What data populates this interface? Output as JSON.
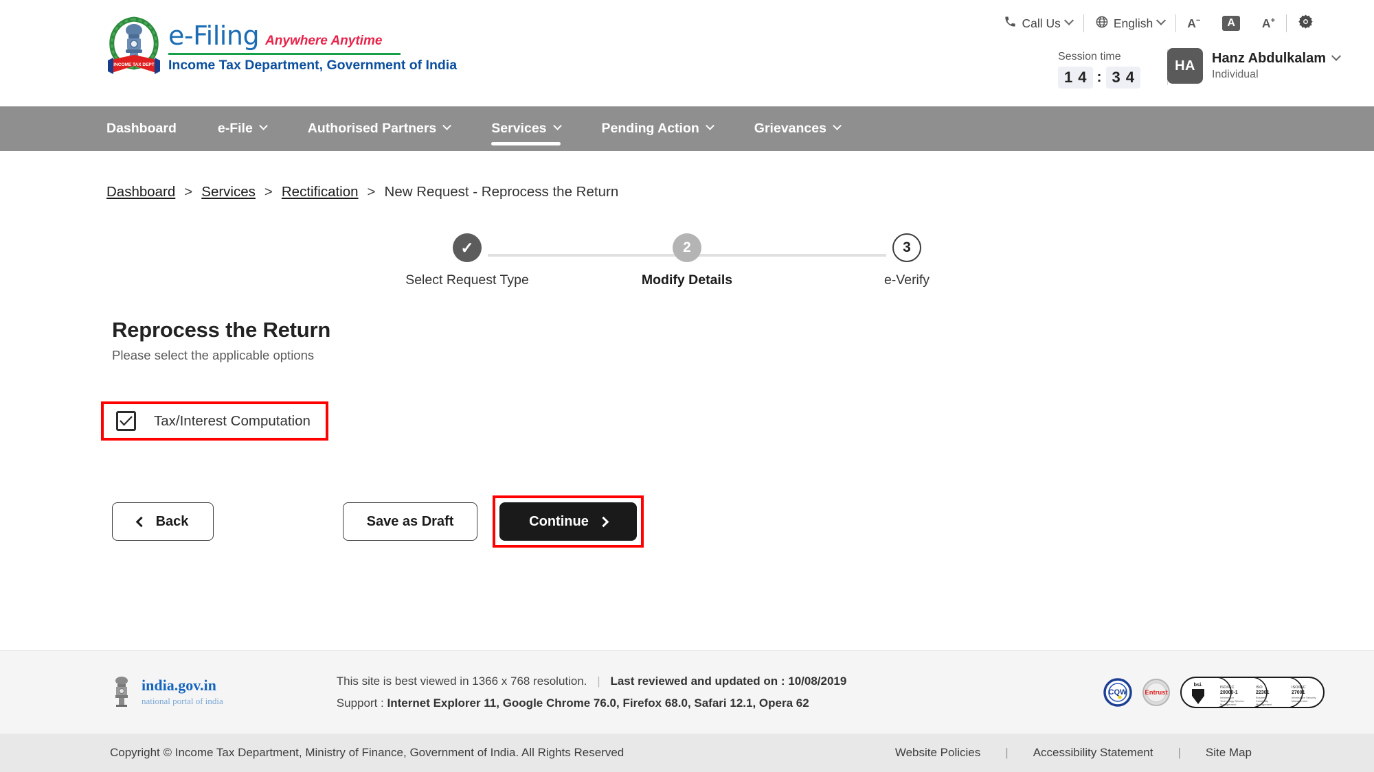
{
  "header": {
    "brand": {
      "title": "e-Filing",
      "tagline": "Anywhere Anytime",
      "subtitle": "Income Tax Department, Government of India"
    },
    "utility": {
      "call_us": "Call Us",
      "language": "English",
      "font_decrease": "A",
      "font_normal": "A",
      "font_increase": "A"
    },
    "session": {
      "label": "Session time",
      "d1": "1",
      "d2": "4",
      "colon": ":",
      "d3": "3",
      "d4": "4"
    },
    "user": {
      "initials": "HA",
      "name": "Hanz Abdulkalam",
      "role": "Individual"
    }
  },
  "nav": {
    "items": [
      {
        "label": "Dashboard",
        "has_caret": false,
        "active": false
      },
      {
        "label": "e-File",
        "has_caret": true,
        "active": false
      },
      {
        "label": "Authorised Partners",
        "has_caret": true,
        "active": false
      },
      {
        "label": "Services",
        "has_caret": true,
        "active": true
      },
      {
        "label": "Pending Action",
        "has_caret": true,
        "active": false
      },
      {
        "label": "Grievances",
        "has_caret": true,
        "active": false
      }
    ]
  },
  "breadcrumb": {
    "items": [
      "Dashboard",
      "Services",
      "Rectification",
      "New Request - Reprocess the Return"
    ],
    "separator": ">"
  },
  "stepper": {
    "steps": [
      {
        "marker": "✓",
        "label": "Select Request Type",
        "state": "done"
      },
      {
        "marker": "2",
        "label": "Modify Details",
        "state": "active"
      },
      {
        "marker": "3",
        "label": "e-Verify",
        "state": "todo"
      }
    ]
  },
  "main": {
    "title": "Reprocess the Return",
    "subtitle": "Please select the applicable options",
    "option": {
      "label": "Tax/Interest Computation",
      "checked": true
    },
    "buttons": {
      "back": "Back",
      "save_draft": "Save as Draft",
      "continue": "Continue"
    }
  },
  "footer": {
    "india_gov": {
      "main": "india.gov.in",
      "sub": "national portal of india"
    },
    "line1a": "This site is best viewed in 1366 x 768 resolution.",
    "line1b": "Last reviewed and updated on : 10/08/2019",
    "line2_prefix": "Support :",
    "line2": "Internet Explorer 11, Google Chrome 76.0,  Firefox 68.0, Safari 12.1, Opera 62",
    "badges": [
      {
        "name": "CQW"
      },
      {
        "name": "Entrust"
      },
      {
        "name": "bsi"
      },
      {
        "name": "ISO/IEC 20000-1",
        "desc": "Information Technology Service Management"
      },
      {
        "name": "ISO 22301",
        "desc": "Business Continuity Management"
      },
      {
        "name": "ISO/IEC 27001",
        "desc": "Information Security Management"
      }
    ],
    "copyright": "Copyright © Income Tax Department, Ministry of Finance, Government of India. All Rights Reserved",
    "links": [
      "Website Policies",
      "Accessibility Statement",
      "Site Map"
    ],
    "link_sep": "|"
  },
  "colors": {
    "brand_blue": "#1a6cb5",
    "brand_red": "#e8234a",
    "brand_green": "#17a04a",
    "navy": "#0b4f9e",
    "nav_bg": "#8f8f8f",
    "highlight": "#ff0000",
    "dark_button": "#1a1a1a"
  }
}
